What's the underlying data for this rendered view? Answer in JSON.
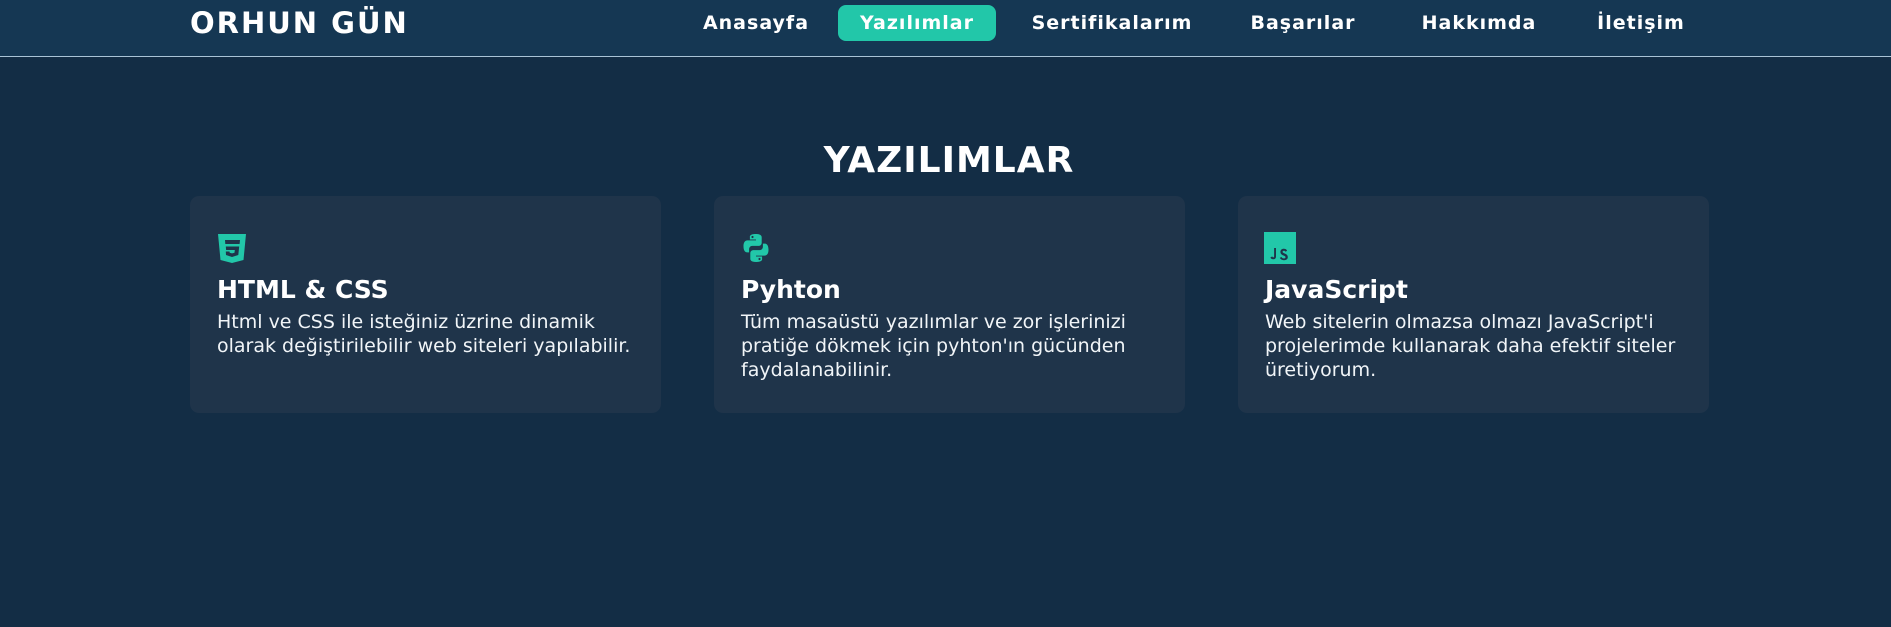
{
  "brand": "ORHUN GÜN",
  "nav": {
    "items": [
      {
        "label": "Anasayfa"
      },
      {
        "label": "Yazılımlar"
      },
      {
        "label": "Sertifikalarım"
      },
      {
        "label": "Başarılar"
      },
      {
        "label": "Hakkımda"
      },
      {
        "label": "İletişim"
      }
    ],
    "active": "Yazılımlar"
  },
  "section": {
    "title": "YAZILIMLAR"
  },
  "cards": [
    {
      "icon": "css3-icon",
      "title": "HTML & CSS",
      "description": "Html ve CSS ile isteğiniz üzrine dinamik olarak değiştirilebilir web siteleri yapılabilir."
    },
    {
      "icon": "python-icon",
      "title": "Pyhton",
      "description": "Tüm masaüstü yazılımlar ve zor işlerinizi pratiğe dökmek için pyhton'ın gücünden faydalanabilinir."
    },
    {
      "icon": "javascript-icon",
      "title": "JavaScript",
      "description": "Web sitelerin olmazsa olmazı JavaScript'i projelerimde kullanarak daha efektif siteler üretiyorum."
    }
  ],
  "colors": {
    "background": "#132d45",
    "navbar": "#153753",
    "card": "#1f344a",
    "accent": "#22c7a9",
    "text": "#ffffff"
  }
}
